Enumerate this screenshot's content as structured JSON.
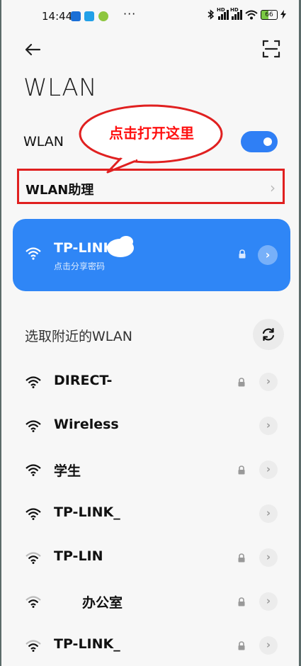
{
  "statusbar": {
    "time": "14:44",
    "dots": "···",
    "battery": "66",
    "net_tag": "HD"
  },
  "header": {
    "title": "WLAN"
  },
  "wlan_toggle": {
    "label": "WLAN",
    "state": "on"
  },
  "annotation": {
    "callout_text": "点击打开这里"
  },
  "assistant": {
    "label": "WLAN助理",
    "chevron": "›"
  },
  "connected": {
    "ssid": "TP-LINK",
    "subtitle": "点击分享密码",
    "chevron": "›"
  },
  "nearby": {
    "title": "选取附近的WLAN",
    "networks": [
      {
        "name": "DIRECT-",
        "locked": true,
        "signal": "full",
        "chevron": "›"
      },
      {
        "name": "Wireless",
        "locked": false,
        "signal": "full",
        "chevron": "›"
      },
      {
        "name": "学生",
        "locked": true,
        "signal": "full",
        "chevron": "›"
      },
      {
        "name": "TP-LINK_",
        "locked": false,
        "signal": "full",
        "chevron": "›"
      },
      {
        "name": "TP-LIN",
        "locked": true,
        "signal": "medium",
        "chevron": "›"
      },
      {
        "name": "办公室",
        "locked": true,
        "signal": "medium",
        "chevron": "›"
      },
      {
        "name": "TP-LINK_",
        "locked": true,
        "signal": "medium",
        "chevron": "›"
      }
    ]
  },
  "colors": {
    "accent": "#2f86f6",
    "annotation": "#e02020"
  }
}
